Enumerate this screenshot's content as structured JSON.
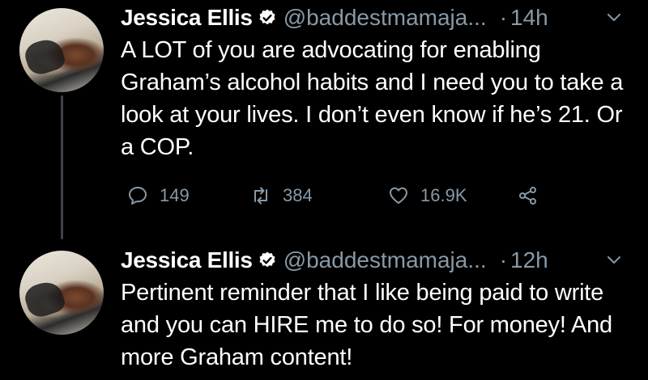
{
  "tweets": [
    {
      "author_name": "Jessica Ellis",
      "handle": "@baddestmamaja...",
      "separator": "·",
      "time": "14h",
      "text": "A LOT of you are advocating for enabling Graham’s alcohol habits and I need you to take a look at your lives. I don’t even know if he’s 21. Or a COP.",
      "replies": "149",
      "retweets": "384",
      "likes": "16.9K"
    },
    {
      "author_name": "Jessica Ellis",
      "handle": "@baddestmamaja...",
      "separator": "·",
      "time": "12h",
      "text": "Pertinent reminder that I like being paid to write and you can HIRE me to do so! For money! And more Graham content!"
    }
  ],
  "icons": {
    "verified": "verified-badge-icon",
    "chevron": "chevron-down-icon",
    "reply": "reply-icon",
    "retweet": "retweet-icon",
    "like": "heart-icon",
    "share": "share-icon"
  },
  "colors": {
    "background": "#000000",
    "text": "#ffffff",
    "secondary": "#8899a6",
    "thread_line": "#3d4248"
  }
}
